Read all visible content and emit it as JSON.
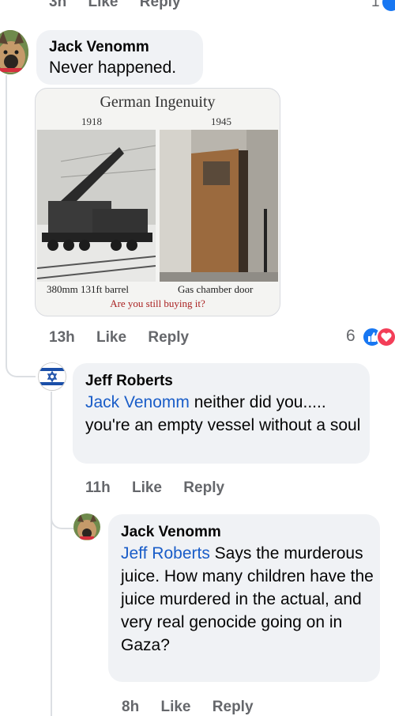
{
  "top_actions": {
    "time": "3h",
    "like": "Like",
    "reply": "Reply"
  },
  "comment1": {
    "author": "Jack Venomm",
    "text": "Never happened.",
    "time": "13h",
    "like": "Like",
    "reply": "Reply",
    "reaction_count": "6",
    "meme": {
      "title": "German Ingenuity",
      "year_left": "1918",
      "year_right": "1945",
      "caption_left": "380mm 131ft barrel",
      "caption_right": "Gas chamber door",
      "question": "Are you still buying it?"
    }
  },
  "comment2": {
    "author": "Jeff Roberts",
    "mention": "Jack Venomm",
    "text": " neither did you..... you're an empty vessel without a soul",
    "time": "11h",
    "like": "Like",
    "reply": "Reply"
  },
  "comment3": {
    "author": "Jack Venomm",
    "mention": "Jeff Roberts",
    "text": " Says the murderous juice. How many children have the juice murdered in the actual, and very real genocide going on in Gaza?",
    "time": "8h",
    "like": "Like",
    "reply": "Reply"
  },
  "colors": {
    "like_blue": "#1877f2",
    "heart_red": "#f33e58",
    "mention": "#1a5dc8"
  }
}
